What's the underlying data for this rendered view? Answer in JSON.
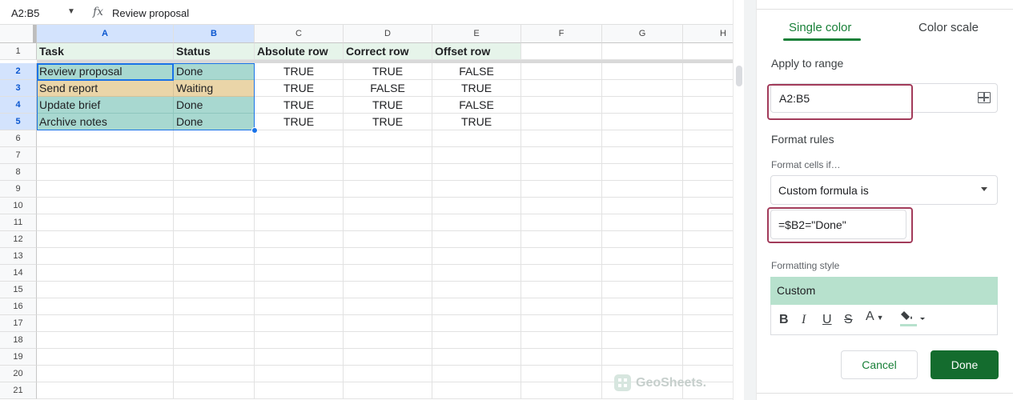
{
  "formula_bar": {
    "name_box": "A2:B5",
    "fx": "fx",
    "formula": "Review proposal"
  },
  "columns": [
    "A",
    "B",
    "C",
    "D",
    "E",
    "F",
    "G",
    "H"
  ],
  "rows": [
    "1",
    "2",
    "3",
    "4",
    "5",
    "6",
    "7",
    "8",
    "9",
    "10",
    "11",
    "12",
    "13",
    "14",
    "15",
    "16",
    "17",
    "18",
    "19",
    "20",
    "21"
  ],
  "table": {
    "headers": [
      "Task",
      "Status",
      "Absolute row",
      "Correct row",
      "Offset row"
    ],
    "data": [
      [
        "Review proposal",
        "Done",
        "TRUE",
        "TRUE",
        "FALSE"
      ],
      [
        "Send report",
        "Waiting",
        "TRUE",
        "FALSE",
        "TRUE"
      ],
      [
        "Update brief",
        "Done",
        "TRUE",
        "TRUE",
        "FALSE"
      ],
      [
        "Archive notes",
        "Done",
        "TRUE",
        "TRUE",
        "TRUE"
      ]
    ]
  },
  "colors": {
    "rule_match": "#a8d8d0",
    "rule_nomatch": "#ead5a8",
    "header_fill": "#e6f4ea",
    "accent_green": "#188038",
    "highlight": "#a23b5a"
  },
  "watermark": "GeoSheets.",
  "panel": {
    "tabs": {
      "single": "Single color",
      "scale": "Color scale"
    },
    "apply_label": "Apply to range",
    "range_value": "A2:B5",
    "format_rules_label": "Format rules",
    "format_cells_if": "Format cells if…",
    "condition": "Custom formula is",
    "formula_value": "=$B2=\"Done\"",
    "formatting_style_label": "Formatting style",
    "style_preview": "Custom",
    "toolbar": {
      "bold": "B",
      "italic": "I",
      "underline": "U",
      "strike": "S",
      "text_color": "A"
    },
    "cancel": "Cancel",
    "done": "Done"
  }
}
